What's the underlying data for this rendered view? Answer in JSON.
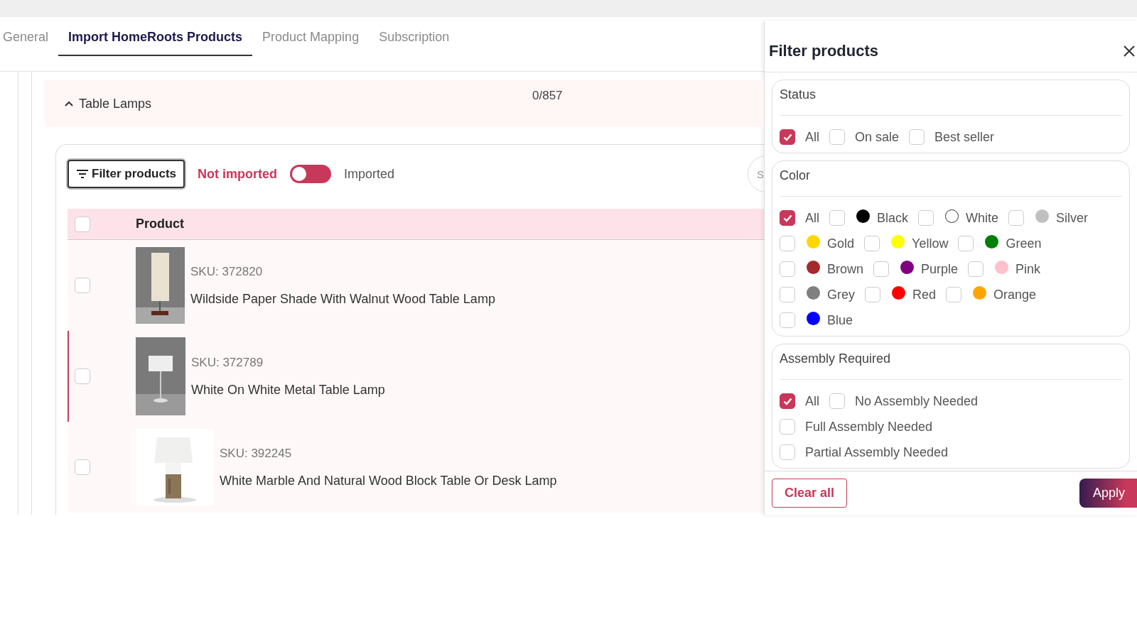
{
  "tabs": [
    {
      "label": "General",
      "selected": false
    },
    {
      "label": "Import HomeRoots Products",
      "selected": true
    },
    {
      "label": "Product Mapping",
      "selected": false
    },
    {
      "label": "Subscription",
      "selected": false
    }
  ],
  "category": {
    "name": "Table Lamps",
    "count": "0/857",
    "expanded": true
  },
  "toolbar": {
    "filter_button": "Filter products",
    "toggle": {
      "left_label": "Not imported",
      "right_label": "Imported",
      "on": false
    },
    "search": {
      "placeholder": "S"
    }
  },
  "table": {
    "header_checked": false,
    "columns": [
      "Product"
    ],
    "rows": [
      {
        "sku": "SKU: 372820",
        "name": "Wildside Paper Shade With Walnut Wood Table Lamp",
        "checked": false,
        "selected": false
      },
      {
        "sku": "SKU: 372789",
        "name": "White On White Metal Table Lamp",
        "checked": false,
        "selected": true
      },
      {
        "sku": "SKU: 392245",
        "name": "White Marble And Natural Wood Block Table Or Desk Lamp",
        "checked": false,
        "selected": false
      }
    ]
  },
  "filter_panel": {
    "title": "Filter products",
    "groups": [
      {
        "title": "Status",
        "options": [
          {
            "label": "All",
            "checked": true
          },
          {
            "label": "On sale",
            "checked": false
          },
          {
            "label": "Best seller",
            "checked": false
          }
        ]
      },
      {
        "title": "Color",
        "options": [
          {
            "label": "All",
            "checked": true
          },
          {
            "label": "Black",
            "checked": false,
            "color": "#000000"
          },
          {
            "label": "White",
            "checked": false,
            "color": "#ffffff"
          },
          {
            "label": "Silver",
            "checked": false,
            "color": "#c0c0c0"
          },
          {
            "label": "Gold",
            "checked": false,
            "color": "#ffd700"
          },
          {
            "label": "Yellow",
            "checked": false,
            "color": "#ffff00"
          },
          {
            "label": "Green",
            "checked": false,
            "color": "#008000"
          },
          {
            "label": "Brown",
            "checked": false,
            "color": "#a52a2a"
          },
          {
            "label": "Purple",
            "checked": false,
            "color": "#800080"
          },
          {
            "label": "Pink",
            "checked": false,
            "color": "#ffc0cb"
          },
          {
            "label": "Grey",
            "checked": false,
            "color": "#808080"
          },
          {
            "label": "Red",
            "checked": false,
            "color": "#ff0000"
          },
          {
            "label": "Orange",
            "checked": false,
            "color": "#ffa500"
          },
          {
            "label": "Blue",
            "checked": false,
            "color": "#0000ff"
          }
        ]
      },
      {
        "title": "Assembly Required",
        "options": [
          {
            "label": "All",
            "checked": true
          },
          {
            "label": "No Assembly Needed",
            "checked": false
          },
          {
            "label": "Full Assembly Needed",
            "checked": false
          },
          {
            "label": "Partial Assembly Needed",
            "checked": false
          }
        ]
      }
    ],
    "buttons": {
      "clear": "Clear all",
      "apply": "Apply"
    }
  }
}
